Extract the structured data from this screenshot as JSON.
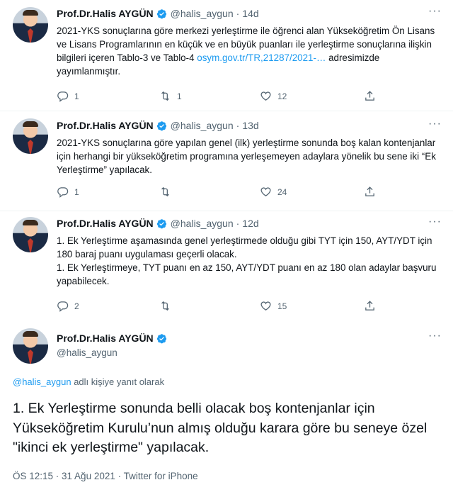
{
  "author": {
    "name": "Prof.Dr.Halis AYGÜN",
    "handle": "@halis_aygun"
  },
  "dot": "·",
  "more": "···",
  "tweets": [
    {
      "time": "14d",
      "text": "2021-YKS sonuçlarına göre merkezi yerleştirme ile öğrenci alan Yükseköğretim Ön Lisans ve Lisans Programlarının en küçük ve en büyük puanları ile  yerleştirme sonuçlarına ilişkin bilgileri içeren Tablo-3 ve Tablo-4 ",
      "link": "osym.gov.tr/TR,21287/2021-…",
      "text_after": " adresimizde yayımlanmıştır.",
      "replies": "1",
      "retweets": "1",
      "likes": "12"
    },
    {
      "time": "13d",
      "text": "2021-YKS sonuçlarına göre yapılan genel (ilk) yerleştirme sonunda boş kalan kontenjanlar için herhangi bir yükseköğretim programına yerleşemeyen adaylara yönelik bu sene iki “Ek Yerleştirme” yapılacak.",
      "replies": "1",
      "retweets": "",
      "likes": "24"
    },
    {
      "time": "12d",
      "text_p1": "1. Ek Yerleştirme aşamasında genel yerleştirmede olduğu gibi TYT için 150, AYT/YDT için 180 baraj puanı uygulaması geçerli olacak.",
      "text_p2": "1. Ek Yerleştirmeye, TYT puanı en az 150, AYT/YDT puanı en az 180 olan adaylar başvuru yapabilecek.",
      "replies": "2",
      "retweets": "",
      "likes": "15"
    }
  ],
  "main": {
    "reply_handle": "@halis_aygun",
    "reply_suffix": " adlı kişiye yanıt olarak",
    "text": "1. Ek Yerleştirme sonunda belli olacak boş kontenjanlar için Yükseköğretim Kurulu’nun almış olduğu karara göre bu seneye özel \"ikinci ek yerleştirme\" yapılacak.",
    "meta": "ÖS 12:15 · 31 Ağu 2021 · Twitter for iPhone"
  },
  "colors": {
    "verified": "#1d9bf0",
    "link": "#1d9bf0",
    "muted": "#536471"
  }
}
